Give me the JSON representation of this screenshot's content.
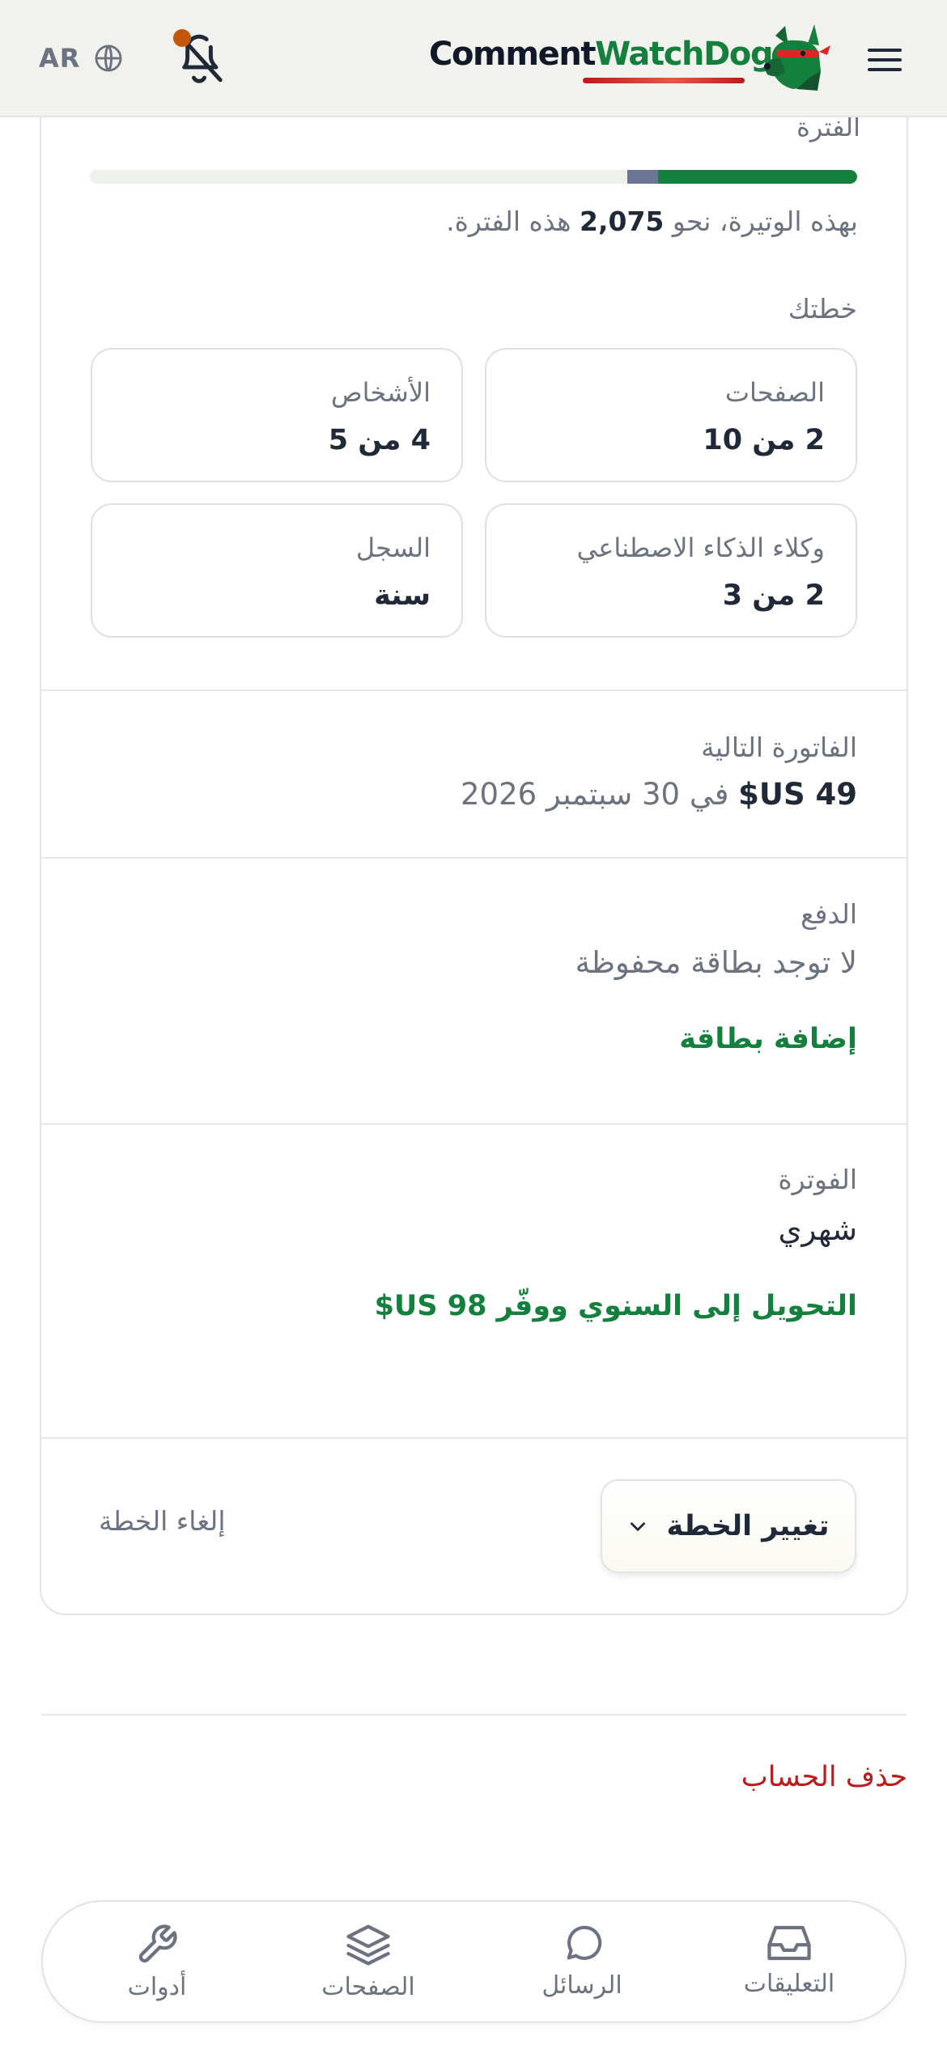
{
  "header": {
    "language_code": "AR",
    "brand_part1": "Comment",
    "brand_part2": "WatchDog"
  },
  "usage": {
    "period_label": "الفترة",
    "progress_used_fraction": 0.26,
    "progress_projected_fraction": 0.04,
    "pace_prefix": "بهذه الوتيرة، نحو",
    "pace_value": "2,075",
    "pace_suffix": "هذه الفترة."
  },
  "plan": {
    "title": "خطتك",
    "tiles": [
      {
        "label": "الصفحات",
        "value": "2 من 10"
      },
      {
        "label": "الأشخاص",
        "value": "4 من 5"
      },
      {
        "label": "وكلاء الذكاء الاصطناعي",
        "value": "2 من 3"
      },
      {
        "label": "السجل",
        "value": "سنة"
      }
    ]
  },
  "next_invoice": {
    "label": "الفاتورة التالية",
    "amount": "49 US$",
    "date_text": "في 30 سبتمبر 2026"
  },
  "payment": {
    "label": "الدفع",
    "value": "لا توجد بطاقة محفوظة",
    "add_card_label": "إضافة بطاقة"
  },
  "billing": {
    "label": "الفوترة",
    "value": "شهري",
    "switch_label": "التحويل إلى السنوي ووفّر 98 US$"
  },
  "actions": {
    "change_plan_label": "تغيير الخطة",
    "cancel_plan_label": "إلغاء الخطة"
  },
  "danger": {
    "delete_account_label": "حذف الحساب"
  },
  "bottom_nav": {
    "comments": "التعليقات",
    "messages": "الرسائل",
    "pages": "الصفحات",
    "tools": "أدوات"
  },
  "colors": {
    "accent_green": "#15803d",
    "danger_red": "#b91c1c",
    "notification_dot": "#c2570c",
    "projection_bar": "#6b7595"
  },
  "icons": [
    "globe-icon",
    "bell-off-icon",
    "dog-mascot-icon",
    "menu-icon",
    "chevron-down-icon",
    "inbox-icon",
    "chat-bubble-icon",
    "layers-icon",
    "wrench-icon"
  ]
}
